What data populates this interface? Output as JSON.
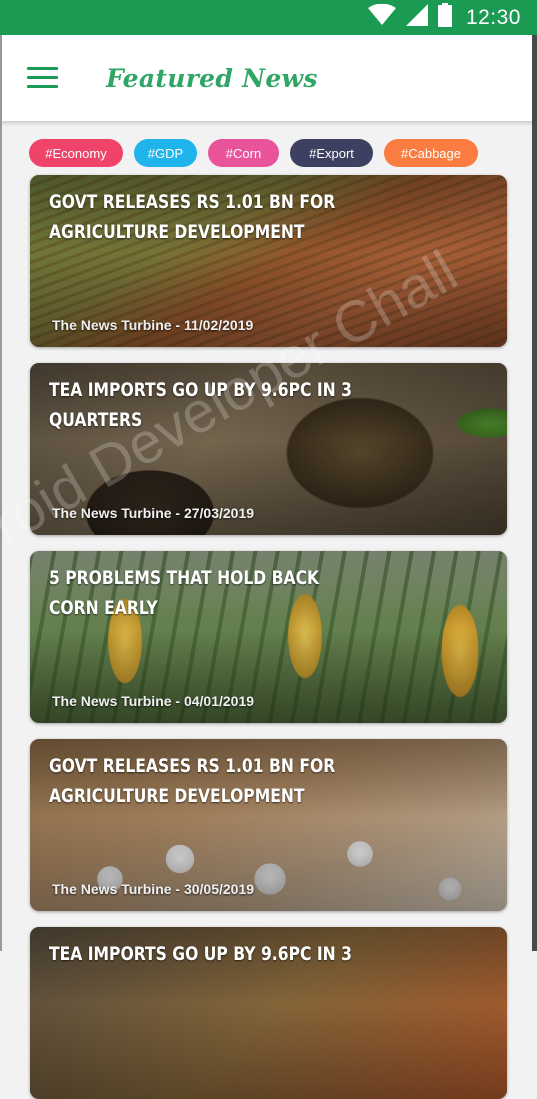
{
  "status_bar": {
    "time": "12:30",
    "icons": [
      "wifi-icon",
      "signal-icon",
      "battery-icon"
    ],
    "color": "#1a9a52"
  },
  "app_bar": {
    "title": "Featured News",
    "menu_icon": "hamburger-menu-icon",
    "accent": "#2fa665"
  },
  "tags": [
    {
      "label": "#Economy",
      "color": "#f0436a"
    },
    {
      "label": "#GDP",
      "color": "#1fb4ec"
    },
    {
      "label": "#Corn",
      "color": "#e9539a"
    },
    {
      "label": "#Export",
      "color": "#3d4060"
    },
    {
      "label": "#Cabbage",
      "color": "#fb7c40"
    }
  ],
  "news": [
    {
      "title": "Govt releases Rs 1.01 bn for agriculture development",
      "meta": "The News Turbine - 11/02/2019"
    },
    {
      "title": "Tea imports go up by 9.6pc in 3 quarters",
      "meta": "The News Turbine - 27/03/2019"
    },
    {
      "title": "5 problems that hold back corn early",
      "meta": "The News Turbine - 04/01/2019"
    },
    {
      "title": "Govt releases Rs 1.01 bn for agriculture development",
      "meta": "The News Turbine - 30/05/2019"
    },
    {
      "title": "Tea imports go up by 9.6pc in 3",
      "meta": ""
    }
  ],
  "watermark": "roid Developer Chall"
}
